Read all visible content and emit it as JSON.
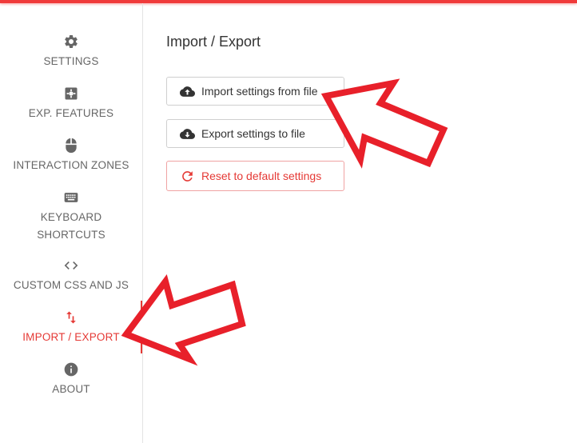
{
  "sidebar": {
    "items": [
      {
        "label": "SETTINGS",
        "icon": "gear-icon"
      },
      {
        "label": "EXP. FEATURES",
        "icon": "puzzle-icon"
      },
      {
        "label": "INTERACTION ZONES",
        "icon": "mouse-icon"
      },
      {
        "label_line1": "KEYBOARD",
        "label_line2": "SHORTCUTS",
        "icon": "keyboard-icon"
      },
      {
        "label": "CUSTOM CSS AND JS",
        "icon": "code-icon"
      },
      {
        "label": "IMPORT / EXPORT",
        "icon": "swap-vertical-icon",
        "active": true
      },
      {
        "label": "ABOUT",
        "icon": "info-icon"
      }
    ]
  },
  "main": {
    "title": "Import / Export",
    "buttons": {
      "import_label": "Import settings from file",
      "export_label": "Export settings to file",
      "reset_label": "Reset to default settings"
    }
  },
  "colors": {
    "accent": "#e53935",
    "top_bar": "#f03a3a",
    "annotation_arrow": "#e8202a",
    "text_muted": "#666666"
  }
}
